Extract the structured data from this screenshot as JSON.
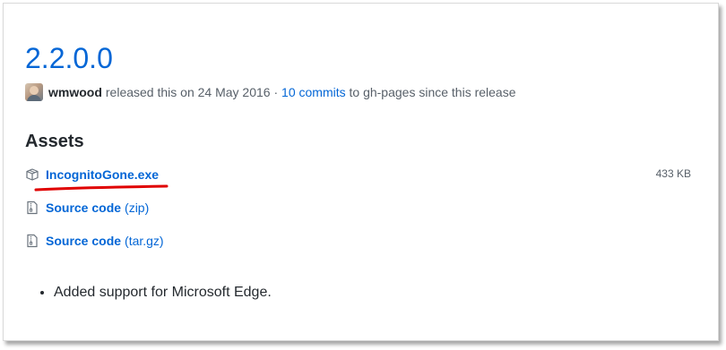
{
  "release": {
    "version": "2.2.0.0",
    "author": "wmwood",
    "released_text": "released this on 24 May 2016",
    "separator": "·",
    "commits_link": "10 commits",
    "commits_suffix": "to gh-pages since this release"
  },
  "assets": {
    "title": "Assets",
    "items": [
      {
        "name": "IncognitoGone.exe",
        "ext": "",
        "size": "433 KB",
        "icon": "package-icon"
      },
      {
        "name": "Source code",
        "ext": "(zip)",
        "icon": "file-zip-icon"
      },
      {
        "name": "Source code",
        "ext": "(tar.gz)",
        "icon": "file-zip-icon"
      }
    ]
  },
  "notes": [
    "Added support for Microsoft Edge."
  ],
  "colors": {
    "link": "#0366d6",
    "text": "#24292e",
    "muted": "#586069",
    "annotation": "#e00000"
  }
}
